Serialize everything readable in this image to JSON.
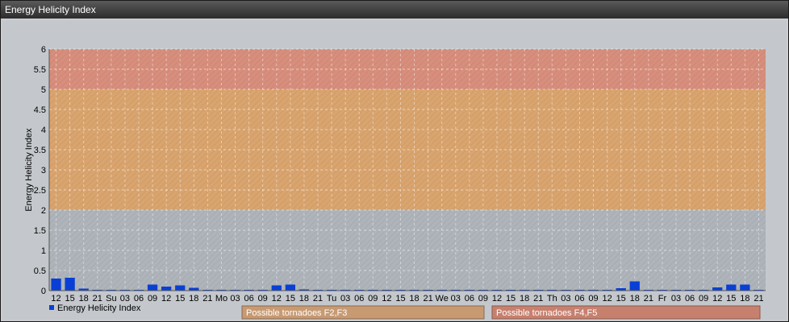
{
  "window": {
    "title": "Energy Helicity Index"
  },
  "colors": {
    "band_low": "#aeb4ba",
    "band_mid": "#d9a46e",
    "band_high": "#d88e7c",
    "bar": "#0a3fd6",
    "panel": "#c4c8cc"
  },
  "legend": {
    "series_label": "Energy Helicity Index",
    "tornado_f23": "Possible tornadoes F2,F3",
    "tornado_f45": "Possible tornadoes F4,F5"
  },
  "chart_data": {
    "type": "bar",
    "ylabel": "Energy Helicity Index",
    "ylim": [
      0,
      6
    ],
    "yticks": [
      0,
      0.5,
      1,
      1.5,
      2,
      2.5,
      3,
      3.5,
      4,
      4.5,
      5,
      5.5,
      6
    ],
    "grid": true,
    "bands": [
      {
        "from": 0,
        "to": 2,
        "color_key": "band_low"
      },
      {
        "from": 2,
        "to": 5,
        "color_key": "band_mid"
      },
      {
        "from": 5,
        "to": 6,
        "color_key": "band_high"
      }
    ],
    "categories": [
      "12",
      "15",
      "18",
      "21",
      "Su",
      "03",
      "06",
      "09",
      "12",
      "15",
      "18",
      "21",
      "Mo",
      "03",
      "06",
      "09",
      "12",
      "15",
      "18",
      "21",
      "Tu",
      "03",
      "06",
      "09",
      "12",
      "15",
      "18",
      "21",
      "We",
      "03",
      "06",
      "09",
      "12",
      "15",
      "18",
      "21",
      "Th",
      "03",
      "06",
      "09",
      "12",
      "15",
      "18",
      "21",
      "Fr",
      "03",
      "06",
      "09",
      "12",
      "15",
      "18",
      "21"
    ],
    "series": [
      {
        "name": "Energy Helicity Index",
        "values": [
          0.3,
          0.32,
          0.05,
          0.02,
          0.02,
          0.02,
          0.02,
          0.15,
          0.1,
          0.13,
          0.07,
          0.02,
          0.02,
          0.02,
          0.02,
          0.02,
          0.13,
          0.15,
          0.03,
          0.02,
          0.02,
          0.02,
          0.02,
          0.02,
          0.02,
          0.02,
          0.02,
          0.02,
          0.02,
          0.02,
          0.02,
          0.02,
          0.02,
          0.02,
          0.02,
          0.02,
          0.02,
          0.02,
          0.02,
          0.02,
          0.02,
          0.06,
          0.23,
          0.02,
          0.02,
          0.02,
          0.02,
          0.02,
          0.08,
          0.15,
          0.15,
          0.02
        ]
      }
    ]
  }
}
